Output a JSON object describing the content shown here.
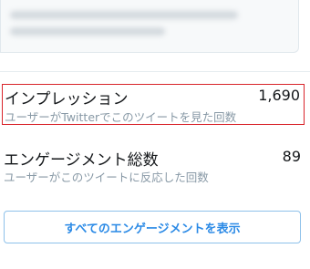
{
  "metrics": [
    {
      "title": "インプレッション",
      "description": "ユーザーがTwitterでこのツイートを見た回数",
      "value": "1,690"
    },
    {
      "title": "エンゲージメント総数",
      "description": "ユーザーがこのツイートに反応した回数",
      "value": "89"
    }
  ],
  "actions": {
    "view_all_engagements_label": "すべてのエンゲージメントを表示"
  },
  "colors": {
    "highlight_border": "#d9242b",
    "link_blue": "#2b8ae6",
    "secondary_text": "#8899a6"
  }
}
